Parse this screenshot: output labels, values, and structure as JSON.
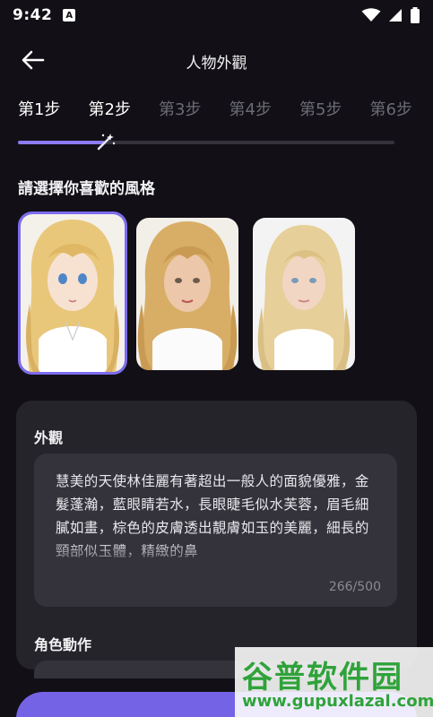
{
  "status_bar": {
    "time": "9:42",
    "app_icon_letter": "A"
  },
  "header": {
    "title": "人物外觀",
    "back_icon": "arrow-left-icon"
  },
  "steps": [
    {
      "label": "第1步",
      "active": true
    },
    {
      "label": "第2步",
      "active": true
    },
    {
      "label": "第3步",
      "active": false
    },
    {
      "label": "第4步",
      "active": false
    },
    {
      "label": "第5步",
      "active": false
    },
    {
      "label": "第6步",
      "active": false
    }
  ],
  "progress": {
    "fraction": 0.23,
    "wand_icon": "magic-wand-icon"
  },
  "style_section": {
    "title": "請選擇你喜歡的風格",
    "options": [
      {
        "name": "style-anime",
        "selected": true
      },
      {
        "name": "style-semi-realistic",
        "selected": false
      },
      {
        "name": "style-realistic",
        "selected": false
      }
    ]
  },
  "appearance": {
    "label": "外觀",
    "text": "慧美的天使林佳麗有著超出一般人的面貌優雅，金髮蓬瀚，藍眼睛若水，長眼睫毛似水芙蓉，眉毛細膩如畫，棕色的皮膚透出靚膚如玉的美麗，細長的頸部似玉體，精緻的鼻",
    "count": "266/500"
  },
  "action": {
    "label": "角色動作"
  },
  "watermark": {
    "main": "谷普软件园",
    "sub": "www.gupuxlazal.com"
  },
  "colors": {
    "background": "#121016",
    "accent": "#7563e6",
    "panel": "#25242b",
    "input": "#34333b"
  }
}
